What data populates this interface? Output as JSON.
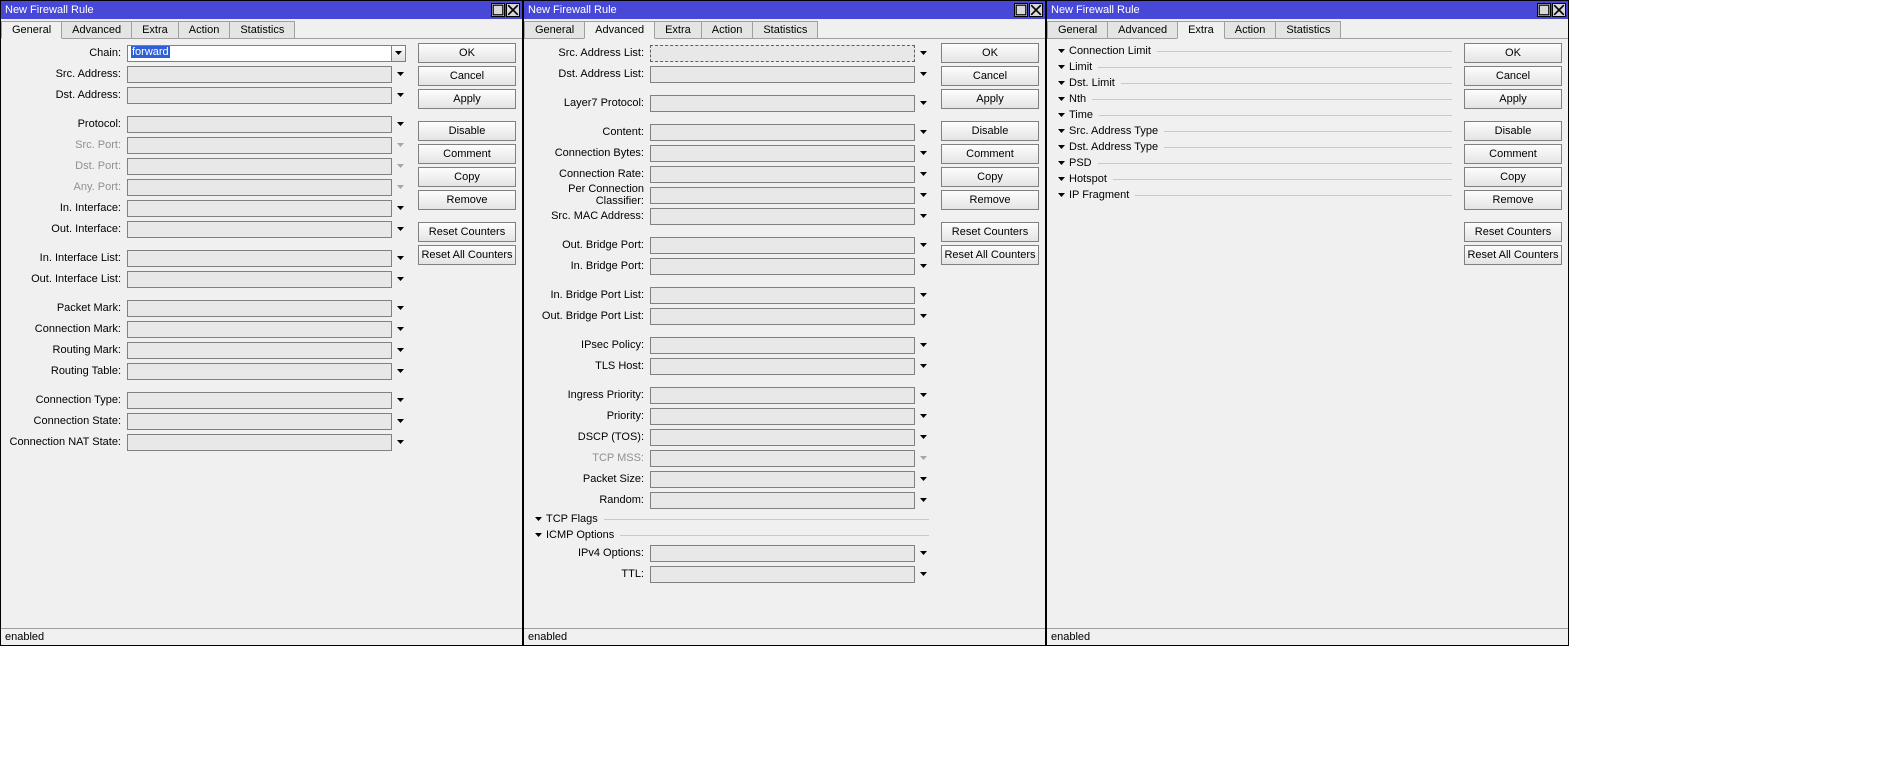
{
  "windows": [
    {
      "title": "New Firewall Rule",
      "activeTab": "General",
      "status": "enabled",
      "chainValue": "forward",
      "chainSelected": true
    },
    {
      "title": "New Firewall Rule",
      "activeTab": "Advanced",
      "status": "enabled"
    },
    {
      "title": "New Firewall Rule",
      "activeTab": "Extra",
      "status": "enabled"
    }
  ],
  "tabs": [
    "General",
    "Advanced",
    "Extra",
    "Action",
    "Statistics"
  ],
  "buttons": {
    "ok": "OK",
    "cancel": "Cancel",
    "apply": "Apply",
    "disable": "Disable",
    "comment": "Comment",
    "copy": "Copy",
    "remove": "Remove",
    "resetCounters": "Reset Counters",
    "resetAllCounters": "Reset All Counters"
  },
  "generalFields": {
    "chain": "Chain:",
    "srcAddress": "Src. Address:",
    "dstAddress": "Dst. Address:",
    "protocol": "Protocol:",
    "srcPort": "Src. Port:",
    "dstPort": "Dst. Port:",
    "anyPort": "Any. Port:",
    "inInterface": "In. Interface:",
    "outInterface": "Out. Interface:",
    "inInterfaceList": "In. Interface List:",
    "outInterfaceList": "Out. Interface List:",
    "packetMark": "Packet Mark:",
    "connectionMark": "Connection Mark:",
    "routingMark": "Routing Mark:",
    "routingTable": "Routing Table:",
    "connectionType": "Connection Type:",
    "connectionState": "Connection State:",
    "connectionNatState": "Connection NAT State:"
  },
  "advancedFields": {
    "srcAddressList": "Src. Address List:",
    "dstAddressList": "Dst. Address List:",
    "layer7Protocol": "Layer7 Protocol:",
    "content": "Content:",
    "connectionBytes": "Connection Bytes:",
    "connectionRate": "Connection Rate:",
    "perConnectionClassifier": "Per Connection Classifier:",
    "srcMacAddress": "Src. MAC Address:",
    "outBridgePort": "Out. Bridge Port:",
    "inBridgePort": "In. Bridge Port:",
    "inBridgePortList": "In. Bridge Port List:",
    "outBridgePortList": "Out. Bridge Port List:",
    "ipsecPolicy": "IPsec Policy:",
    "tlsHost": "TLS Host:",
    "ingressPriority": "Ingress Priority:",
    "priority": "Priority:",
    "dscpTos": "DSCP (TOS):",
    "tcpMss": "TCP MSS:",
    "packetSize": "Packet Size:",
    "random": "Random:",
    "tcpFlags": "TCP Flags",
    "icmpOptions": "ICMP Options",
    "ipv4Options": "IPv4 Options:",
    "ttl": "TTL:"
  },
  "extraExpanders": [
    "Connection Limit",
    "Limit",
    "Dst. Limit",
    "Nth",
    "Time",
    "Src. Address Type",
    "Dst. Address Type",
    "PSD",
    "Hotspot",
    "IP Fragment"
  ]
}
